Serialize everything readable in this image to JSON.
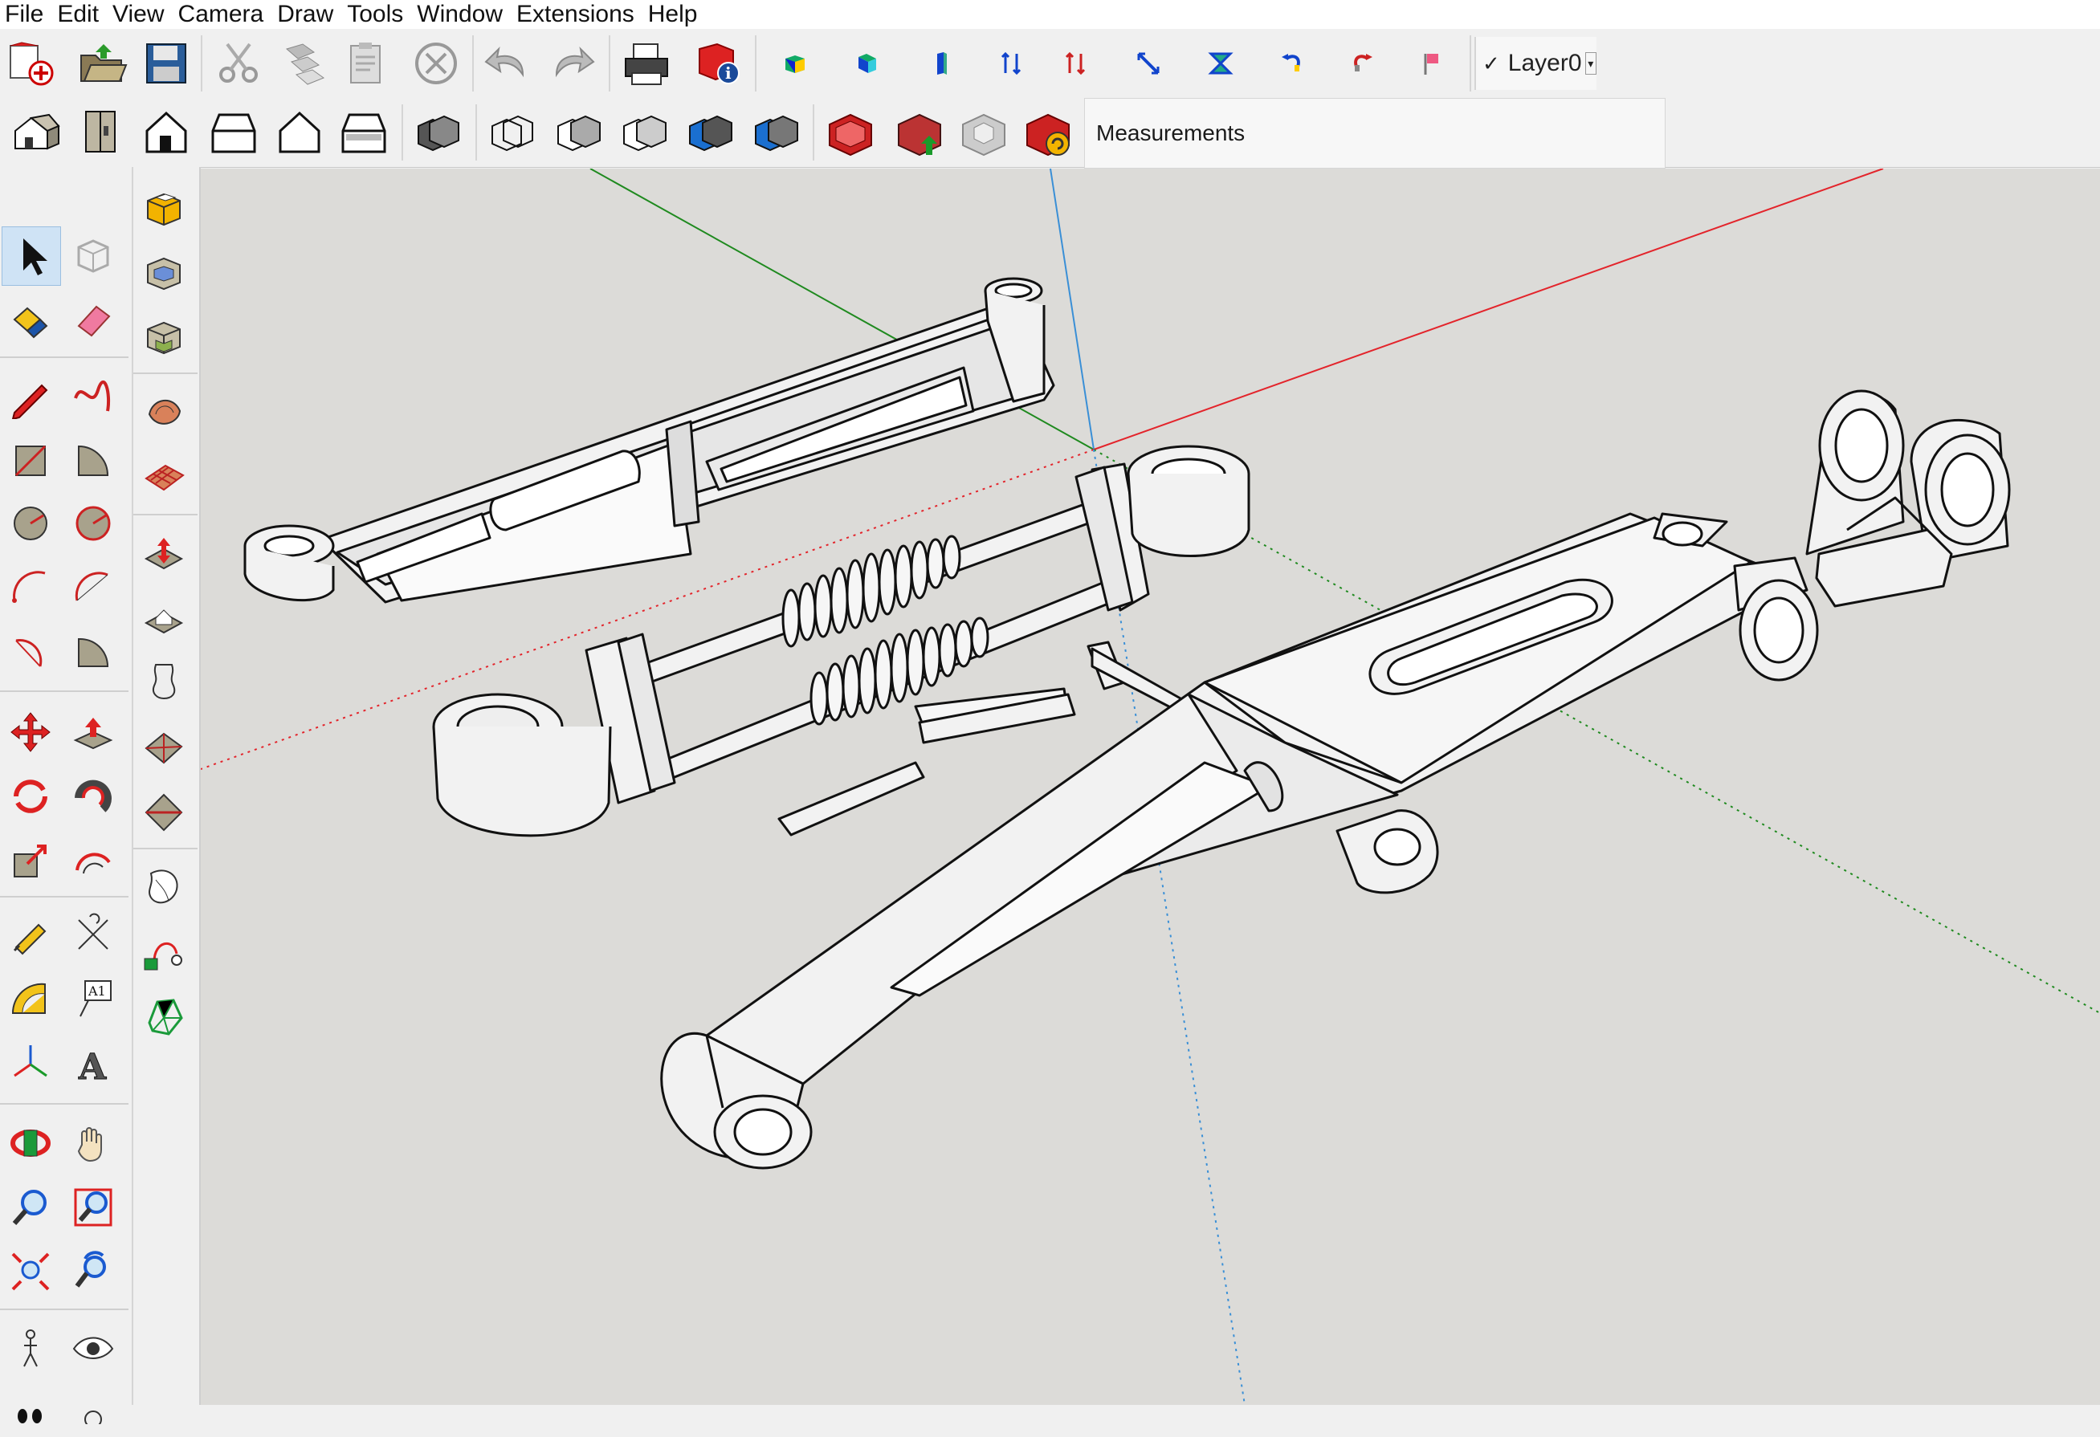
{
  "menu": [
    "File",
    "Edit",
    "View",
    "Camera",
    "Draw",
    "Tools",
    "Window",
    "Extensions",
    "Help"
  ],
  "toolbar1": {
    "buttons": [
      "new-model",
      "open-model",
      "save-model",
      "cut",
      "copy",
      "paste",
      "erase",
      "undo",
      "redo",
      "print",
      "model-info",
      "view-iso-tool",
      "view-top-tool",
      "view-front-tool",
      "view-up-tool",
      "view-down-tool",
      "view-diag-tool",
      "view-flip-tool",
      "rotate-left-tool",
      "rotate-right-tool",
      "flag-tool"
    ],
    "layer": {
      "check": "✓",
      "name": "Layer0"
    }
  },
  "toolbar2": {
    "buttons": [
      "iso-view",
      "top-view",
      "front-view",
      "right-view",
      "back-view",
      "left-view",
      "xray",
      "wireframe",
      "hidden-line",
      "shaded",
      "shaded-textures",
      "monochrome",
      "warehouse",
      "share-model",
      "extension-warehouse",
      "send-to-layout"
    ],
    "measurements_label": "Measurements",
    "measurements_value": ""
  },
  "left_tools": [
    "select",
    "component",
    "paint-bucket",
    "eraser",
    "line",
    "freehand",
    "rectangle",
    "rotated-rectangle",
    "circle",
    "polygon",
    "arc",
    "two-point-arc",
    "three-point-arc",
    "pie",
    "move",
    "push-pull",
    "rotate",
    "follow-me",
    "scale",
    "offset",
    "tape-measure",
    "dimension",
    "protractor",
    "text",
    "axes",
    "3d-text",
    "orbit",
    "pan",
    "zoom",
    "zoom-window",
    "zoom-extents",
    "previous-view",
    "position-camera",
    "look-around",
    "walk",
    "section-plane"
  ],
  "sandbox_tools": [
    "solid-union",
    "solid-subtract",
    "solid-intersect",
    "sandbox-contours",
    "sandbox-scratch",
    "smoove",
    "stamp",
    "drape",
    "add-detail",
    "flip-edge",
    "outer-shell",
    "follow-path",
    "sculpt"
  ],
  "colors": {
    "viewport_bg": "#dcdbd8",
    "axis_red": "#e3242b",
    "axis_green": "#1f8a1f",
    "axis_blue": "#3a8fd6",
    "model_fill": "#f2f2f2"
  }
}
